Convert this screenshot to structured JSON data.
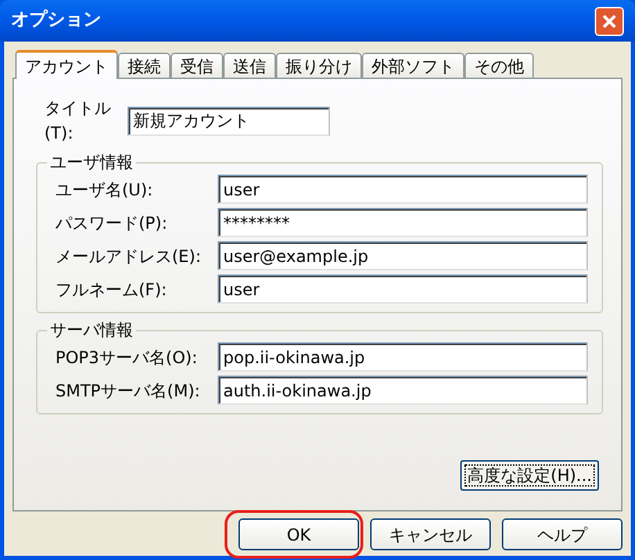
{
  "window": {
    "title": "オプション"
  },
  "tabs": [
    {
      "label": "アカウント",
      "selected": true
    },
    {
      "label": "接続",
      "selected": false
    },
    {
      "label": "受信",
      "selected": false
    },
    {
      "label": "送信",
      "selected": false
    },
    {
      "label": "振り分け",
      "selected": false
    },
    {
      "label": "外部ソフト",
      "selected": false
    },
    {
      "label": "その他",
      "selected": false
    }
  ],
  "title_field": {
    "label": "タイトル(T):",
    "value": "新規アカウント"
  },
  "groups": [
    {
      "title": "ユーザ情報",
      "fields": [
        {
          "label": "ユーザ名(U):",
          "value": "user"
        },
        {
          "label": "パスワード(P):",
          "value": "********"
        },
        {
          "label": "メールアドレス(E):",
          "value": "user@example.jp"
        },
        {
          "label": "フルネーム(F):",
          "value": "user"
        }
      ]
    },
    {
      "title": "サーバ情報",
      "fields": [
        {
          "label": "POP3サーバ名(O):",
          "value": "pop.ii-okinawa.jp"
        },
        {
          "label": "SMTPサーバ名(M):",
          "value": "auth.ii-okinawa.jp"
        }
      ]
    }
  ],
  "advanced_button": "高度な設定(H)...",
  "buttons": [
    {
      "label": "OK",
      "highlighted": true
    },
    {
      "label": "キャンセル",
      "highlighted": false
    },
    {
      "label": "ヘルプ",
      "highlighted": false
    }
  ]
}
